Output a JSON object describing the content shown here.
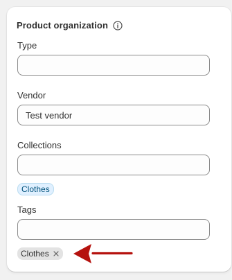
{
  "section": {
    "title": "Product organization",
    "info_icon": "info-icon"
  },
  "fields": {
    "type": {
      "label": "Type",
      "value": "",
      "placeholder": ""
    },
    "vendor": {
      "label": "Vendor",
      "value": "Test vendor",
      "placeholder": ""
    },
    "collections": {
      "label": "Collections",
      "value": "",
      "placeholder": ""
    },
    "tags": {
      "label": "Tags",
      "value": "",
      "placeholder": ""
    }
  },
  "collection_tags": [
    {
      "label": "Clothes"
    }
  ],
  "tags_list": [
    {
      "label": "Clothes",
      "remove_icon": "close-icon"
    }
  ],
  "annotation": {
    "type": "arrow",
    "color": "#b5120e"
  },
  "colors": {
    "collection_tag_bg": "#e0f0ff",
    "collection_tag_text": "#00527c",
    "tag_bg": "#e3e3e3",
    "arrow": "#b5120e"
  }
}
